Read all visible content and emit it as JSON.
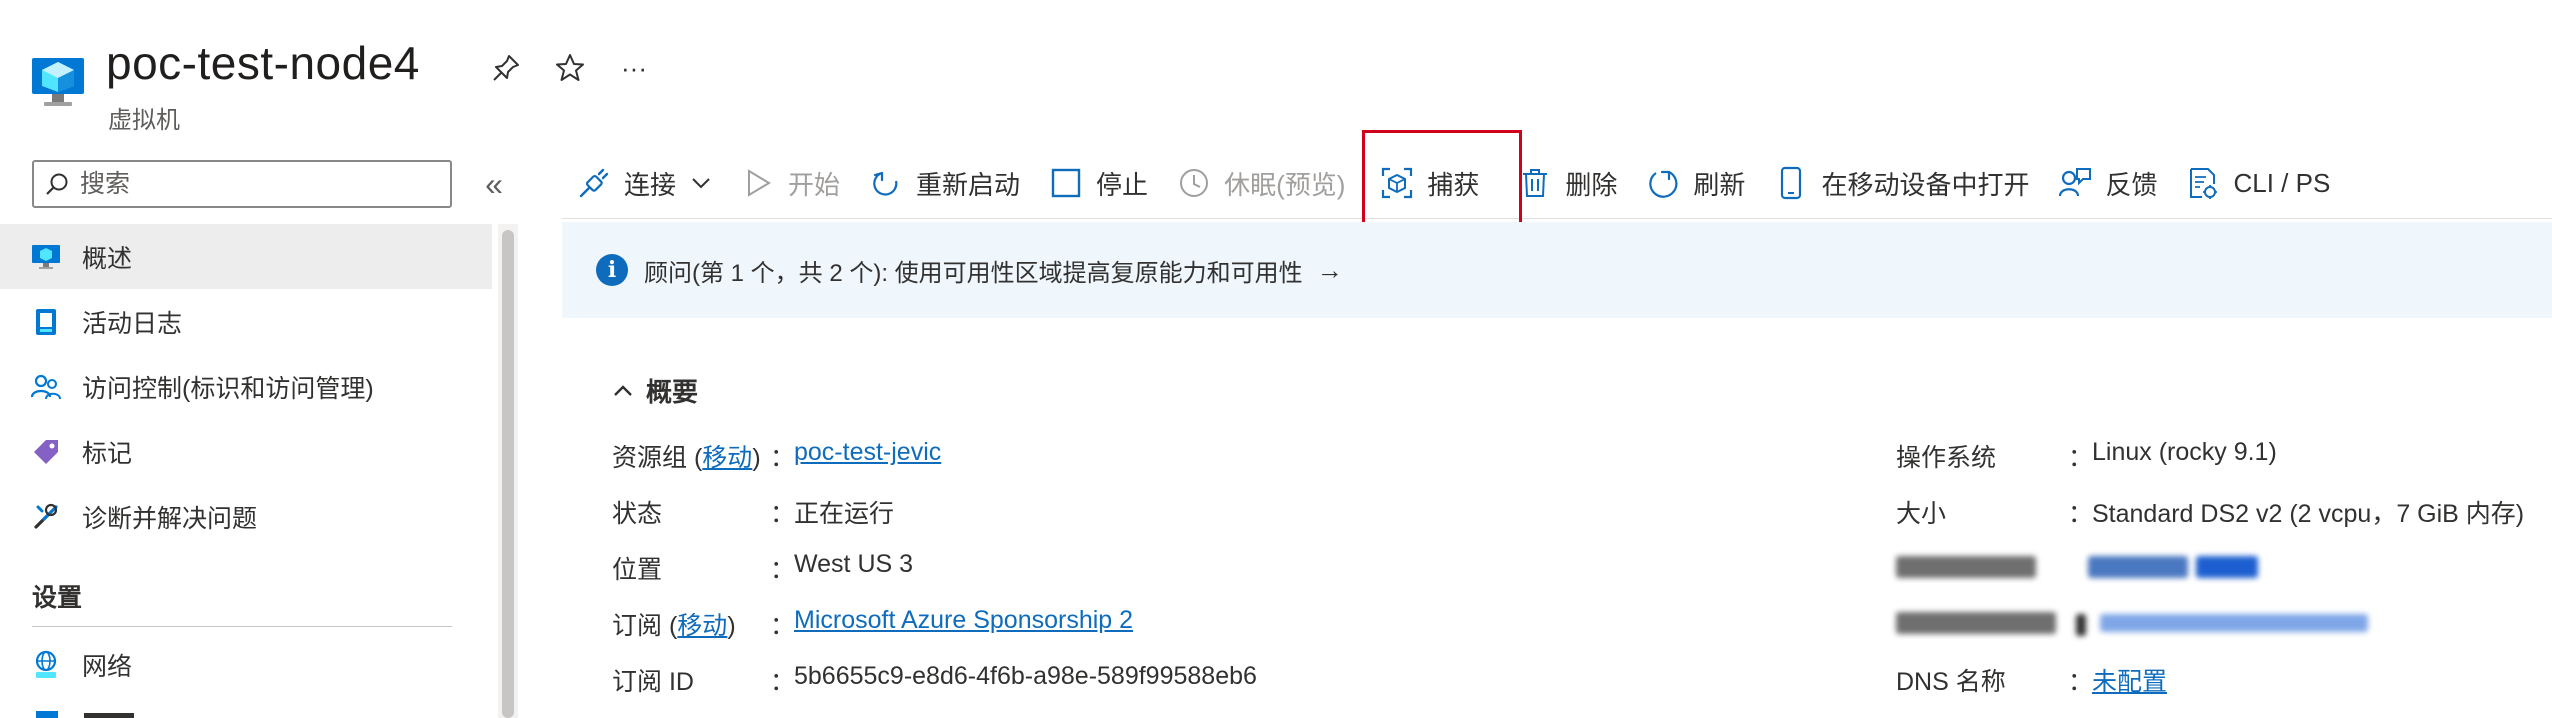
{
  "header": {
    "title": "poc-test-node4",
    "subtitle": "虚拟机",
    "more": "···"
  },
  "sidebar": {
    "search_placeholder": "搜索",
    "collapse": "«",
    "items": [
      {
        "label": "概述",
        "icon": "monitor-icon",
        "active": true
      },
      {
        "label": "活动日志",
        "icon": "log-icon",
        "active": false
      },
      {
        "label": "访问控制(标识和访问管理)",
        "icon": "users-icon",
        "active": false
      },
      {
        "label": "标记",
        "icon": "tag-icon",
        "active": false
      },
      {
        "label": "诊断并解决问题",
        "icon": "wrench-icon",
        "active": false
      }
    ],
    "section_settings": "设置",
    "network_label": "网络"
  },
  "toolbar": {
    "connect": "连接",
    "start": "开始",
    "restart": "重新启动",
    "stop": "停止",
    "hibernate": "休眠(预览)",
    "capture": "捕获",
    "delete": "删除",
    "refresh": "刷新",
    "open_mobile": "在移动设备中打开",
    "feedback": "反馈",
    "cli": "CLI / PS"
  },
  "banner": {
    "text": "顾问(第 1 个，共 2 个): 使用可用性区域提高复原能力和可用性",
    "arrow": "→"
  },
  "essentials": {
    "heading": "概要",
    "left": {
      "resource_group_label": "资源组",
      "move": "移动",
      "resource_group_value": "poc-test-jevic",
      "status_label": "状态",
      "status_value": "正在运行",
      "location_label": "位置",
      "location_value": "West US 3",
      "subscription_label": "订阅",
      "subscription_value": "Microsoft Azure Sponsorship 2",
      "subscription_id_label": "订阅 ID",
      "subscription_id_value": "5b6655c9-e8d6-4f6b-a98e-589f99588eb6"
    },
    "right": {
      "os_label": "操作系统",
      "os_value": "Linux (rocky 9.1)",
      "size_label": "大小",
      "size_value": "Standard DS2 v2 (2 vcpu，7 GiB 内存)",
      "dns_label": "DNS 名称",
      "dns_value": "未配置"
    }
  },
  "colors": {
    "accent": "#0f6cbd",
    "highlight": "#d0021b",
    "banner_bg": "#eff6fc",
    "active_nav": "#ededed"
  }
}
